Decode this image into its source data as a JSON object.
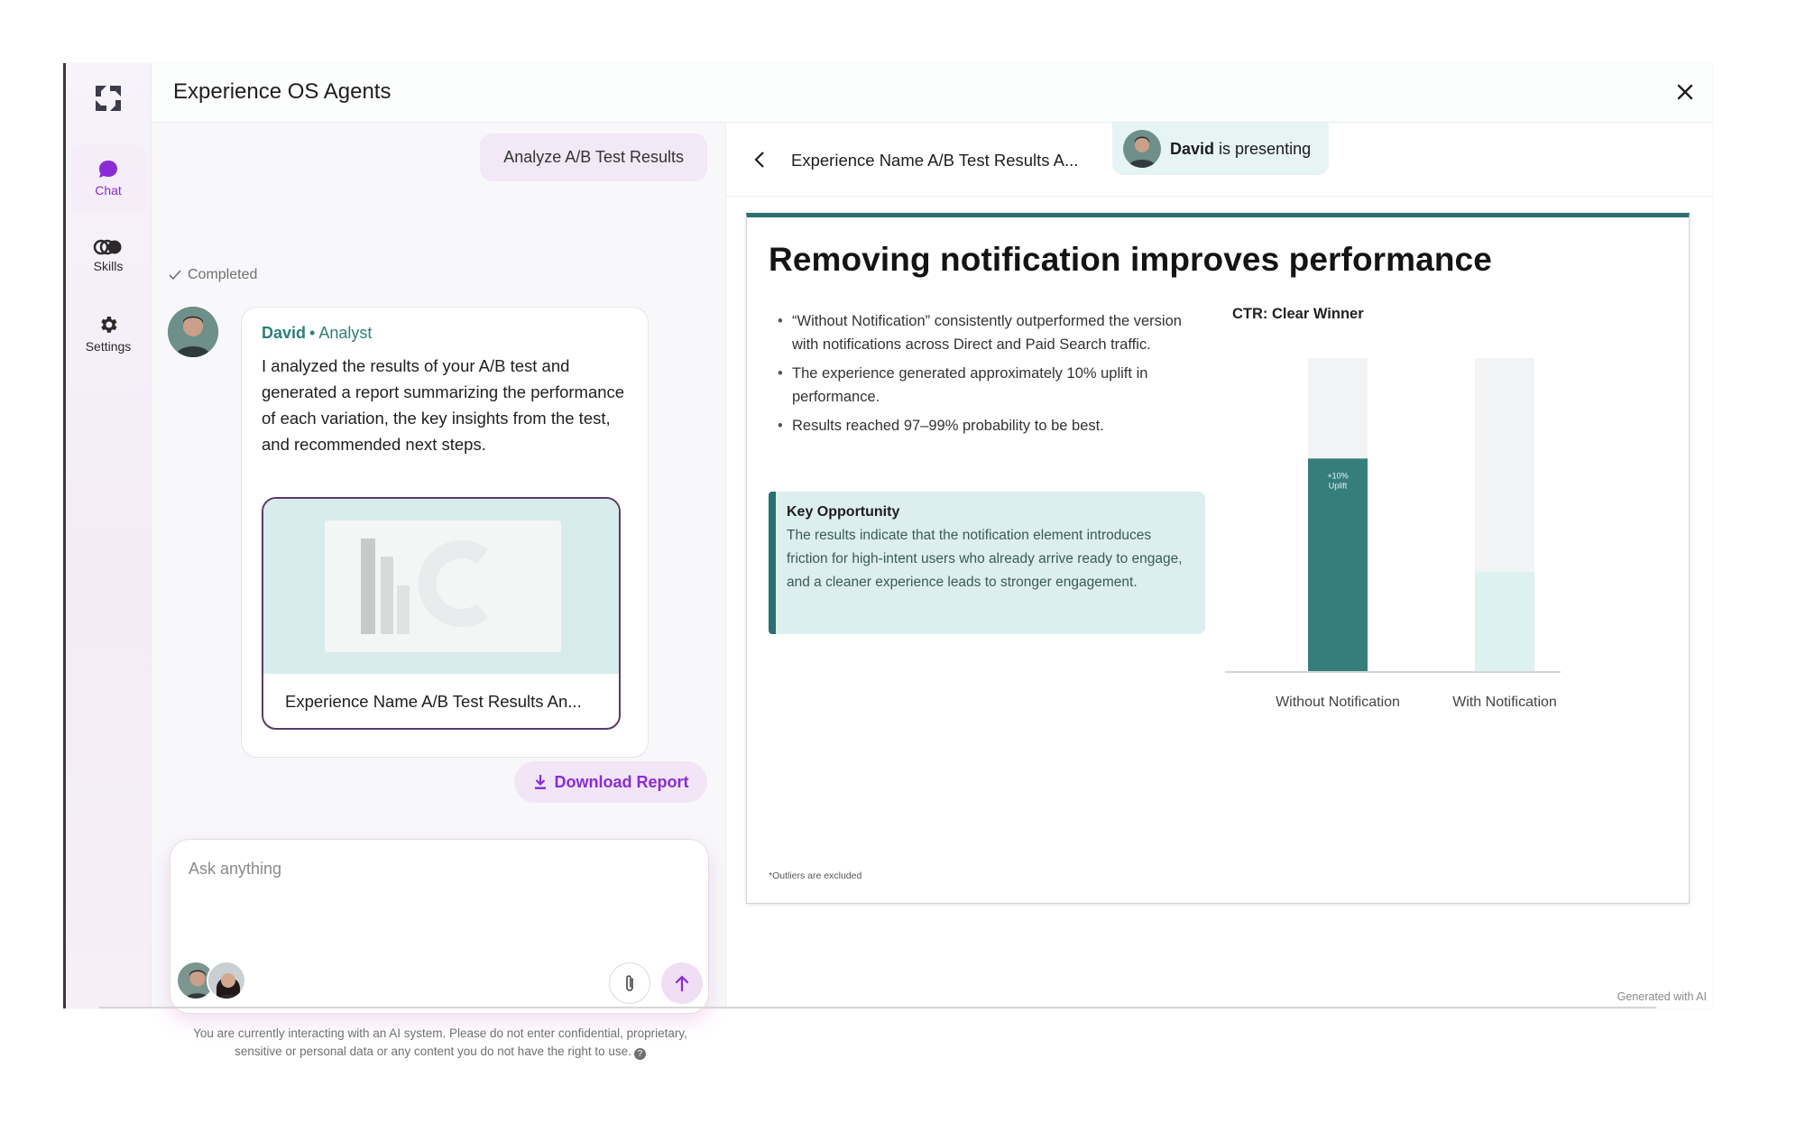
{
  "app": {
    "title": "Experience OS Agents",
    "accent": "#8a2bd6",
    "teal": "#2b6f70"
  },
  "rail": {
    "items": [
      {
        "label": "Chat",
        "icon": "chat-bubble-icon",
        "active": true
      },
      {
        "label": "Skills",
        "icon": "skills-icon",
        "active": false
      },
      {
        "label": "Settings",
        "icon": "gear-icon",
        "active": false
      }
    ]
  },
  "chat": {
    "user_message": "Analyze A/B Test Results",
    "status": "Completed",
    "agent": {
      "name": "David",
      "separator": "•",
      "role": "Analyst",
      "message": "I analyzed the results of your A/B test and generated a report summarizing the performance of each variation, the key insights from the test, and recommended next steps.",
      "report_title": "Experience Name A/B Test Results An..."
    },
    "download_label": "Download Report",
    "composer": {
      "placeholder": "Ask anything"
    },
    "disclaimer": "You are currently interacting with an AI system. Please do not enter confidential, proprietary, sensitive or personal data or any content you do not have the right to use.",
    "help_glyph": "?"
  },
  "preview": {
    "title": "Experience Name A/B Test Results A...",
    "presenter_name": "David",
    "presenter_suffix": " is presenting",
    "footer": "Generated with AI"
  },
  "slide": {
    "heading": "Removing notification improves performance",
    "bullets": [
      "“Without Notification” consistently outperformed the version with notifications across Direct and Paid Search traffic.",
      "The experience generated approximately 10% uplift in performance.",
      "Results reached 97–99% probability to be best."
    ],
    "key_title": "Key Opportunity",
    "key_body": "The results indicate that the notification element introduces friction for high-intent users who already arrive ready to engage, and a cleaner experience leads to stronger engagement.",
    "footnote": "*Outliers are excluded"
  },
  "chart_data": {
    "type": "bar",
    "title": "CTR: Clear Winner",
    "categories": [
      "Without Notification",
      "With Notification"
    ],
    "values": [
      0.68,
      0.32
    ],
    "ylim": [
      0,
      1
    ],
    "annotation": "+10% Uplift",
    "colors": [
      "#357e7b",
      "#dcf1f0"
    ],
    "track_color": "#f2f3f4"
  }
}
